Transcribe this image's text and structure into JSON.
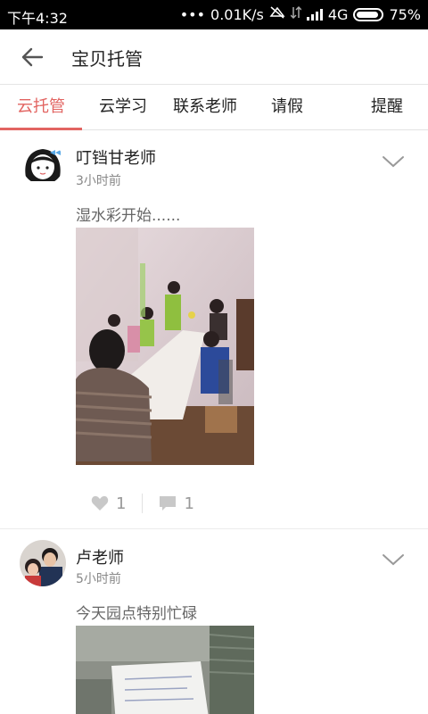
{
  "status_bar": {
    "time": "下午4:32",
    "dots": "•••",
    "speed": "0.01K/s",
    "network": "4G",
    "battery": "75%"
  },
  "header": {
    "title": "宝贝托管"
  },
  "tabs": [
    {
      "label": "云托管",
      "active": true
    },
    {
      "label": "云学习",
      "active": false
    },
    {
      "label": "联系老师",
      "active": false
    },
    {
      "label": "请假",
      "active": false
    },
    {
      "label": "提醒",
      "active": false
    }
  ],
  "posts": [
    {
      "author": "叮铛甘老师",
      "time": "3小时前",
      "text": "湿水彩开始......",
      "likes": "1",
      "comments": "1"
    },
    {
      "author": "卢老师",
      "time": "5小时前",
      "text": "今天园点特别忙碌"
    }
  ],
  "colors": {
    "accent": "#e26461",
    "status_bar_bg": "#000000"
  },
  "icons": {
    "back": "back-arrow-icon",
    "chevron": "chevron-down-icon",
    "like": "heart-icon",
    "comment": "comment-icon"
  }
}
